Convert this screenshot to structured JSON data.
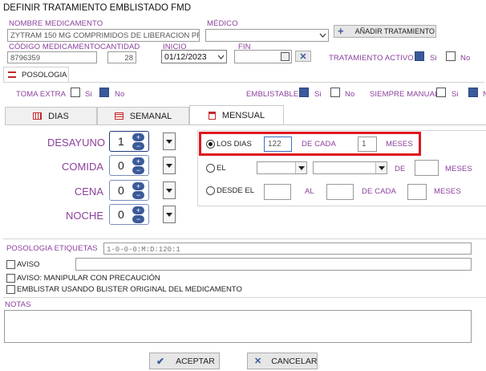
{
  "window": {
    "title": "DEFINIR TRATAMIENTO EMBLISTADO FMD"
  },
  "medicamento": {
    "label": "NOMBRE MEDICAMENTO",
    "value": "ZYTRAM  150 MG COMPRIMIDOS DE LIBERACION PRC"
  },
  "medico": {
    "label": "MÉDICO",
    "value": ""
  },
  "add_treatment": {
    "label": "AÑADIR TRATAMIENTO"
  },
  "codigo": {
    "label": "CÓDIGO MEDICAMENTO",
    "value": "8796359"
  },
  "cantidad": {
    "label": "CANTIDAD",
    "value": "28"
  },
  "inicio": {
    "label": "INICIO",
    "value": "01/12/2023"
  },
  "fin": {
    "label": "FIN",
    "value": ""
  },
  "tratamiento_activo": {
    "label": "TRATAMIENTO ACTIVO",
    "si": "Si",
    "no": "No",
    "selected": "si"
  },
  "posologia_tab": {
    "label": "POSOLOGIA"
  },
  "toma_extra": {
    "label": "TOMA EXTRA",
    "si": "Si",
    "no": "No",
    "selected": "no"
  },
  "emblistable": {
    "label": "EMBLISTABLE",
    "si": "Si",
    "no": "No",
    "selected": "si"
  },
  "siempre_manual": {
    "label": "SIEMPRE MANUAL",
    "si": "Si",
    "no": "No",
    "selected": "no"
  },
  "tabs": [
    {
      "label": "DIAS",
      "icon": "calendar-grid-icon"
    },
    {
      "label": "SEMANAL",
      "icon": "calendar-week-icon"
    },
    {
      "label": "MENSUAL",
      "icon": "calendar-month-icon"
    }
  ],
  "meals": [
    {
      "label": "DESAYUNO",
      "value": "1"
    },
    {
      "label": "COMIDA",
      "value": "0"
    },
    {
      "label": "CENA",
      "value": "0"
    },
    {
      "label": "NOCHE",
      "value": "0"
    }
  ],
  "mensual": {
    "los_dias": {
      "label": "LOS DIAS",
      "value": "122",
      "de_cada": "DE CADA",
      "cada_value": "1",
      "meses": "MESES"
    },
    "el": {
      "label": "EL",
      "de": "DE",
      "meses": "MESES"
    },
    "desde_el": {
      "label": "DESDE EL",
      "al": "AL",
      "de_cada": "DE CADA",
      "meses": "MESES"
    }
  },
  "etiquetas": {
    "label": "POSOLOGIA ETIQUETAS",
    "value": "1-0-0-0:M:D:120:1"
  },
  "aviso": {
    "label": "AVISO",
    "value": ""
  },
  "aviso_manipular": {
    "label": "AVISO: MANIPULAR CON PRECAUCIÓN"
  },
  "emblistar_original": {
    "label": "EMBLISTAR USANDO BLISTER ORIGINAL DEL MEDICAMENTO"
  },
  "notas": {
    "label": "NOTAS",
    "value": ""
  },
  "footer": {
    "accept": "ACEPTAR",
    "cancel": "CANCELAR"
  },
  "colors": {
    "accent": "#8b3f9c",
    "checked": "#3b5a9a",
    "highlight": "#e0161f"
  }
}
